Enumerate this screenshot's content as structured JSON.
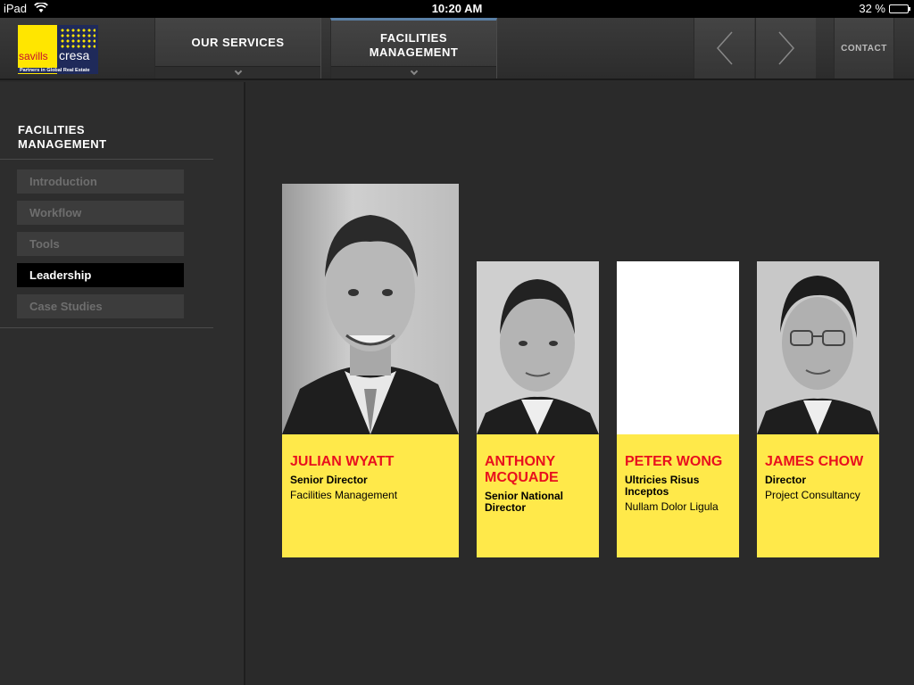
{
  "status": {
    "device": "iPad",
    "time": "10:20 AM",
    "battery": "32 %",
    "battery_level": 0.32
  },
  "logo": {
    "word1": "savills",
    "word2": "cresa",
    "tagline": "Partners in Global Real Estate"
  },
  "nav": {
    "tabs": [
      {
        "label": "OUR SERVICES"
      },
      {
        "label": "FACILITIES MANAGEMENT"
      }
    ],
    "contact": "CONTACT"
  },
  "sidebar": {
    "title": "FACILITIES MANAGEMENT",
    "items": [
      {
        "label": "Introduction"
      },
      {
        "label": "Workflow"
      },
      {
        "label": "Tools"
      },
      {
        "label": "Leadership"
      },
      {
        "label": "Case Studies"
      }
    ],
    "active": "Leadership"
  },
  "people": [
    {
      "name": "JULIAN WYATT",
      "role": "Senior Director",
      "dept": "Facilities Management"
    },
    {
      "name": "ANTHONY MCQUADE",
      "role": "Senior National Director",
      "dept": ""
    },
    {
      "name": "PETER WONG",
      "role": "Ultricies Risus Inceptos",
      "dept": "Nullam Dolor Ligula"
    },
    {
      "name": "JAMES CHOW",
      "role": "Director",
      "dept": "Project Consultancy"
    }
  ],
  "colors": {
    "accent_yellow": "#ffe94a",
    "name_red": "#e8101e",
    "brand_navy": "#1f2a5a"
  }
}
